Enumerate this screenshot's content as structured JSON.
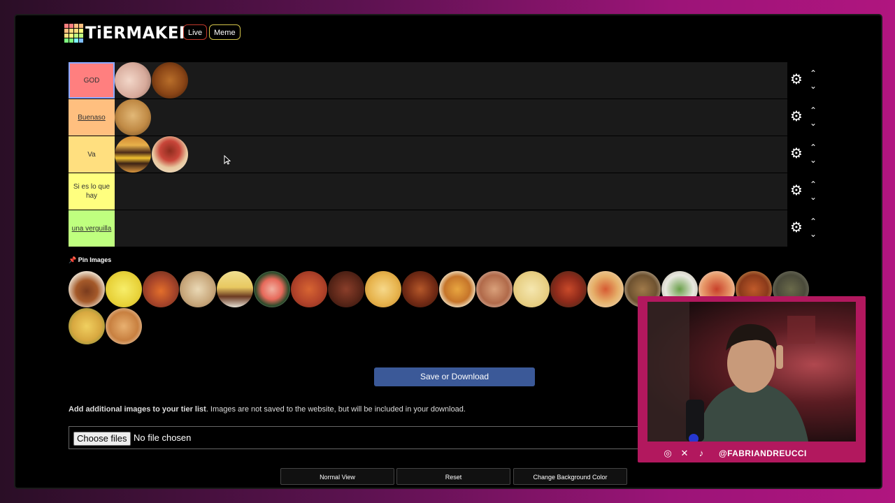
{
  "header": {
    "logo_text": "TiERMAKER",
    "live_label": "Live",
    "meme_label": "Meme"
  },
  "tiers": [
    {
      "label": "GOD",
      "color": "#ff7f7f",
      "items": 2
    },
    {
      "label": "Buenaso",
      "color": "#ffbf7f",
      "items": 1
    },
    {
      "label": "Va",
      "color": "#ffdf7f",
      "items": 2
    },
    {
      "label": "Si es lo que hay",
      "color": "#ffff7f",
      "items": 0
    },
    {
      "label": "una verguilla",
      "color": "#bfff7f",
      "items": 0
    }
  ],
  "pin_label": "Pin Images",
  "pool_count": 22,
  "save_label": "Save or Download",
  "info": {
    "bold": "Add additional images to your tier list",
    "rest": ". Images are not saved to the website, but will be included in your download."
  },
  "file_input": {
    "button_label": "Choose files",
    "status": "No file chosen"
  },
  "bottom_buttons": {
    "normal_view": "Normal View",
    "reset": "Reset",
    "change_bg": "Change Background Color"
  },
  "stream": {
    "handle": "@FABRIANDREUCCI",
    "icons": [
      "instagram-icon",
      "x-icon",
      "tiktok-icon"
    ]
  }
}
